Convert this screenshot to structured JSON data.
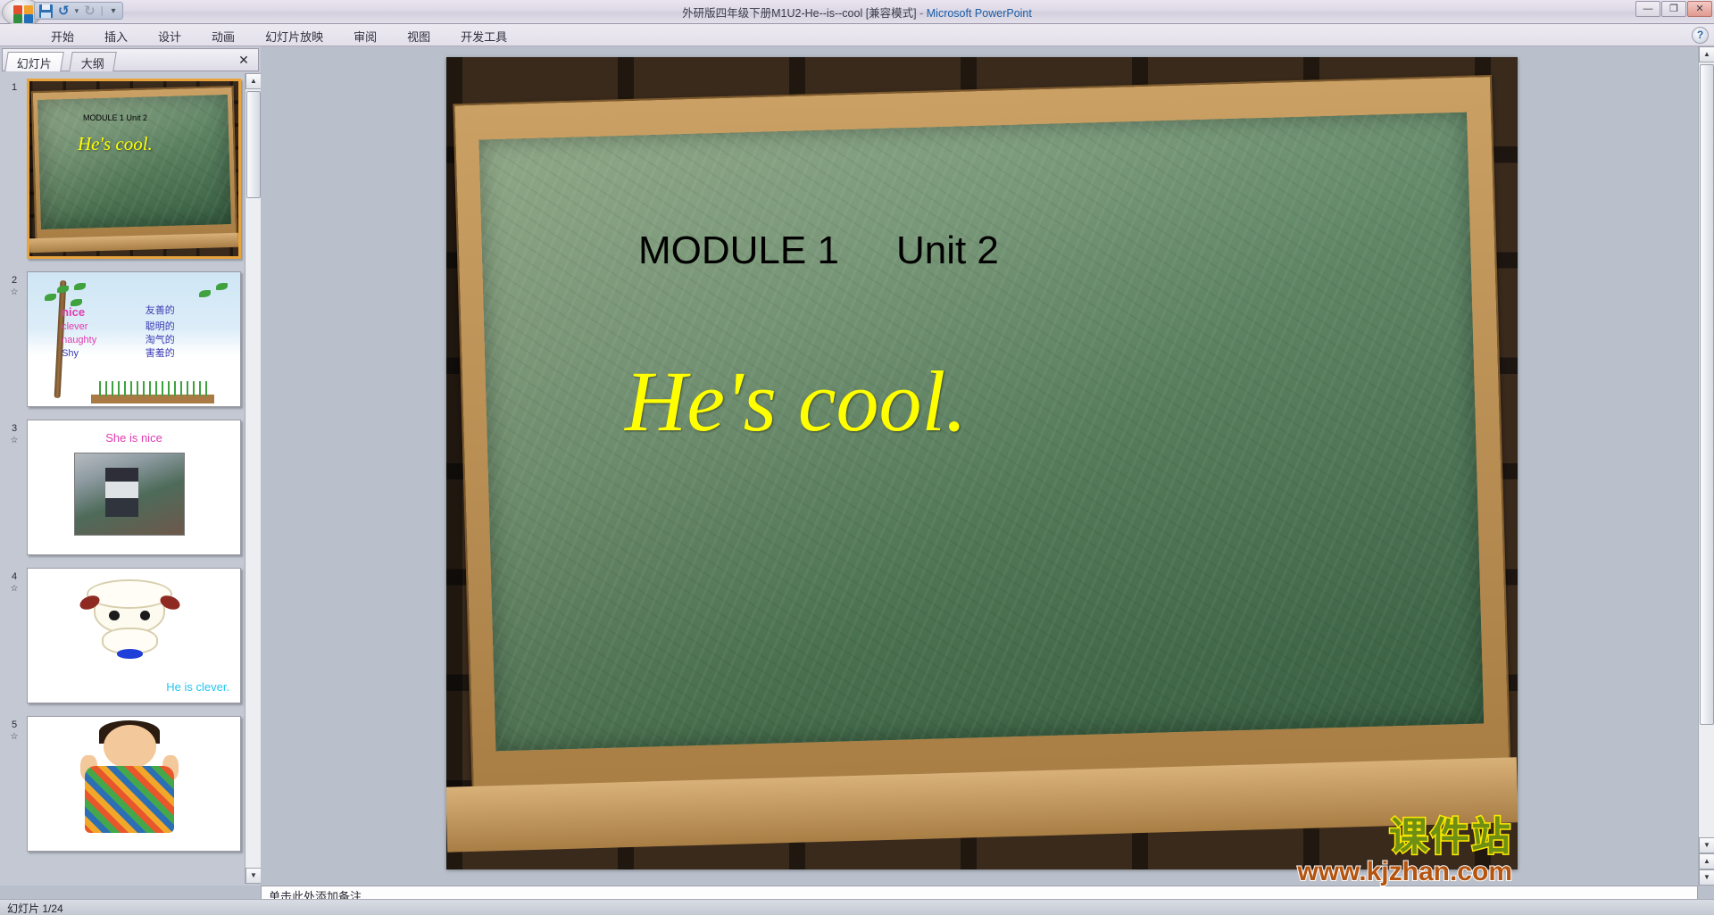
{
  "window": {
    "doc_title": "外研版四年级下册M1U2-He--is--cool [兼容模式]",
    "separator": " - ",
    "app_name": "Microsoft PowerPoint",
    "minimize_label": "—",
    "maximize_label": "❐",
    "close_label": "✕",
    "help_label": "?"
  },
  "quick_access": {
    "save_title": "保存",
    "undo_glyph": "↺",
    "undo_drop": "▾",
    "redo_glyph": "↻",
    "separator": "|",
    "customize_glyph": "▾"
  },
  "ribbon": {
    "tabs": [
      {
        "label": "开始"
      },
      {
        "label": "插入"
      },
      {
        "label": "设计"
      },
      {
        "label": "动画"
      },
      {
        "label": "幻灯片放映"
      },
      {
        "label": "审阅"
      },
      {
        "label": "视图"
      },
      {
        "label": "开发工具"
      }
    ]
  },
  "left_pane": {
    "tabs": [
      {
        "label": "幻灯片"
      },
      {
        "label": "大纲"
      }
    ],
    "close_label": "✕",
    "scroll_up": "▲",
    "scroll_down": "▼",
    "thumbnails": [
      {
        "number": "1",
        "kind": "blackboard",
        "title": "MODULE 1     Unit 2",
        "hero": "He's cool."
      },
      {
        "number": "2",
        "star": "☆",
        "kind": "vocab",
        "rows": [
          {
            "en": "nice",
            "cn": "友善的"
          },
          {
            "en": "clever",
            "cn": "聪明的"
          },
          {
            "en": "naughty",
            "cn": "淘气的"
          },
          {
            "en": "Shy",
            "cn": "害羞的"
          }
        ]
      },
      {
        "number": "3",
        "star": "☆",
        "kind": "photo",
        "title": "She is nice"
      },
      {
        "number": "4",
        "star": "☆",
        "kind": "sheep",
        "caption": "He is clever."
      },
      {
        "number": "5",
        "star": "☆",
        "kind": "boy",
        "caption": ""
      }
    ]
  },
  "slide": {
    "title_part1": "MODULE 1",
    "title_part2": "Unit 2",
    "hero": "He's cool.",
    "watermark_cn": "课件站",
    "watermark_url": "www.kjzhan.com",
    "colors": {
      "hero_text": "#ffff00",
      "board_green": "#4e7a55",
      "frame_wood": "#caa064",
      "watermark_green": "#6f8f12",
      "watermark_yellow": "#ffe800",
      "watermark_orange": "#b5540e"
    }
  },
  "notes": {
    "placeholder": "单击此处添加备注"
  },
  "status": {
    "slide_counter": "幻灯片 1/24"
  },
  "stage_scroll": {
    "up": "▲",
    "down": "▼",
    "prev_slide": "▲",
    "next_slide": "▼"
  }
}
